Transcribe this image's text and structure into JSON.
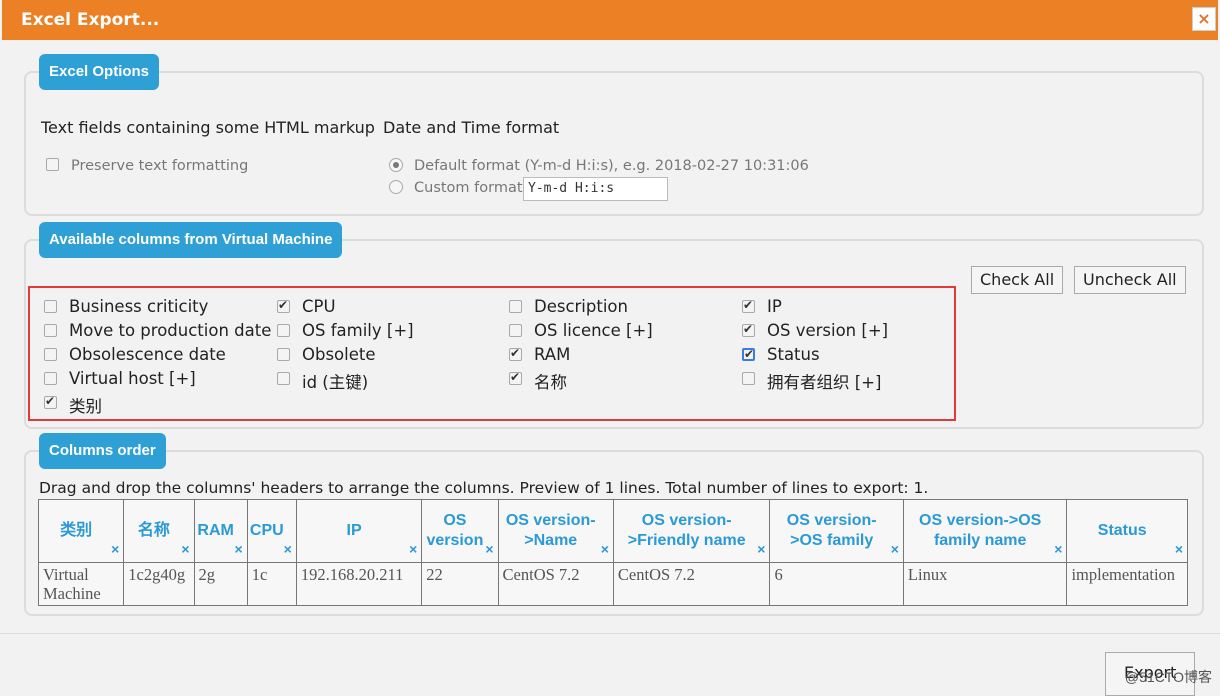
{
  "dialog": {
    "title": "Excel Export...",
    "close_glyph": "×",
    "close_icon": "close-icon"
  },
  "options": {
    "legend": "Excel Options",
    "html_markup": {
      "heading": "Text fields containing some HTML markup",
      "preserve_label": "Preserve text formatting",
      "preserve_checked": false
    },
    "datetime": {
      "heading": "Date and Time format",
      "default_label": "Default format (Y-m-d H:i:s), e.g. 2018-02-27 10:31:06",
      "custom_label": "Custom format:",
      "custom_value": "Y-m-d H:i:s",
      "selected": "default"
    }
  },
  "available": {
    "legend": "Available columns from Virtual Machine",
    "check_all": "Check All",
    "uncheck_all": "Uncheck All",
    "columns": [
      [
        {
          "label": "Business criticity",
          "checked": false
        },
        {
          "label": "Move to production date",
          "checked": false
        },
        {
          "label": "Obsolescence date",
          "checked": false
        },
        {
          "label": "Virtual host [+]",
          "checked": false
        },
        {
          "label": "类别",
          "checked": true
        }
      ],
      [
        {
          "label": "CPU",
          "checked": true
        },
        {
          "label": "OS family [+]",
          "checked": false
        },
        {
          "label": "Obsolete",
          "checked": false
        },
        {
          "label": "id (主键)",
          "checked": false
        }
      ],
      [
        {
          "label": "Description",
          "checked": false
        },
        {
          "label": "OS licence [+]",
          "checked": false
        },
        {
          "label": "RAM",
          "checked": true
        },
        {
          "label": "名称",
          "checked": true
        }
      ],
      [
        {
          "label": "IP",
          "checked": true
        },
        {
          "label": "OS version [+]",
          "checked": true
        },
        {
          "label": "Status",
          "checked": true
        },
        {
          "label": "拥有者组织 [+]",
          "checked": false
        }
      ]
    ]
  },
  "order": {
    "legend": "Columns order",
    "description": "Drag and drop the columns' headers to arrange the columns. Preview of 1 lines. Total number of lines to export: 1.",
    "remove_glyph": "×",
    "headers": [
      "类别",
      "名称",
      "RAM",
      "CPU",
      "IP",
      "OS version",
      "OS version->Name",
      "OS version->Friendly name",
      "OS version->OS family",
      "OS version->OS family name",
      "Status"
    ],
    "rows": [
      [
        "Virtual Machine",
        "1c2g40g",
        "2g",
        "1c",
        "192.168.20.211",
        "22",
        "CentOS 7.2",
        "CentOS 7.2",
        "6",
        "Linux",
        "implementation"
      ]
    ]
  },
  "footer": {
    "export_label": "Export",
    "watermark": "@51CTO博客"
  },
  "colors": {
    "titlebar": "#eb8025",
    "legend": "#2fa0d6",
    "header_text": "#2a9ad6",
    "highlight": "#e13a3a"
  }
}
